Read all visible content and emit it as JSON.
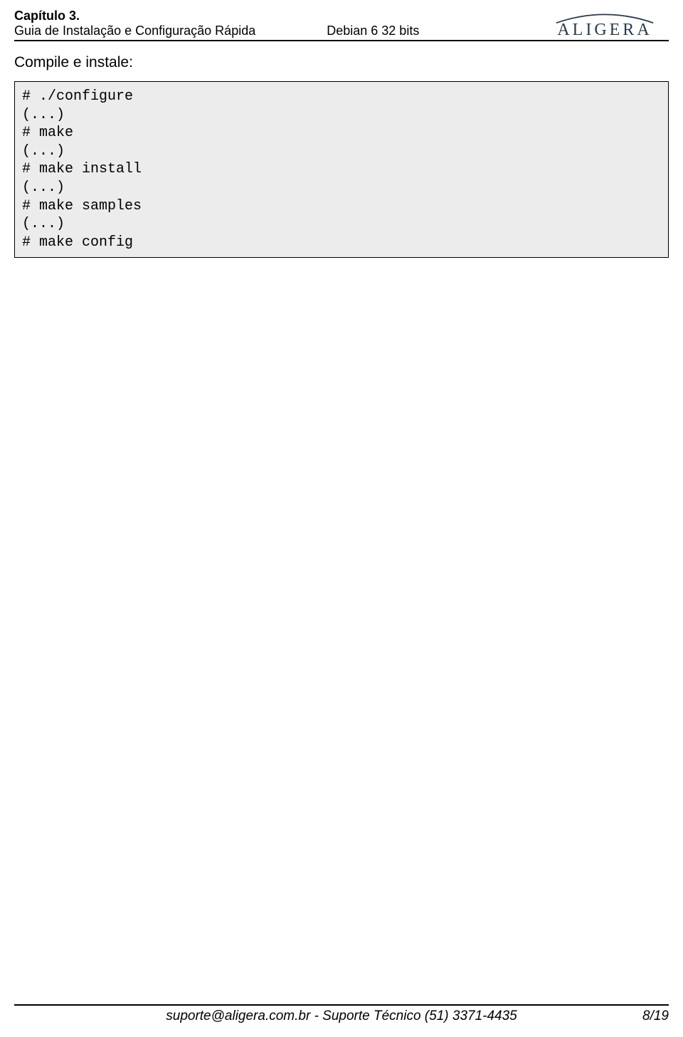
{
  "header": {
    "chapter": "Capítulo 3.",
    "guide": "Guia de Instalação e Configuração Rápida",
    "distro": "Debian 6 32 bits",
    "logo_text": "ALIGERA"
  },
  "body": {
    "intro": "Compile e instale:"
  },
  "code": {
    "l1": "# ./configure",
    "l2": "(...)",
    "l3": "# make",
    "l4": "(...)",
    "l5": "# make install",
    "l6": "(...)",
    "l7": "# make samples",
    "l8": "(...)",
    "l9": "# make config"
  },
  "footer": {
    "contact": "suporte@aligera.com.br - Suporte Técnico (51) 3371-4435",
    "page": "8/19"
  }
}
